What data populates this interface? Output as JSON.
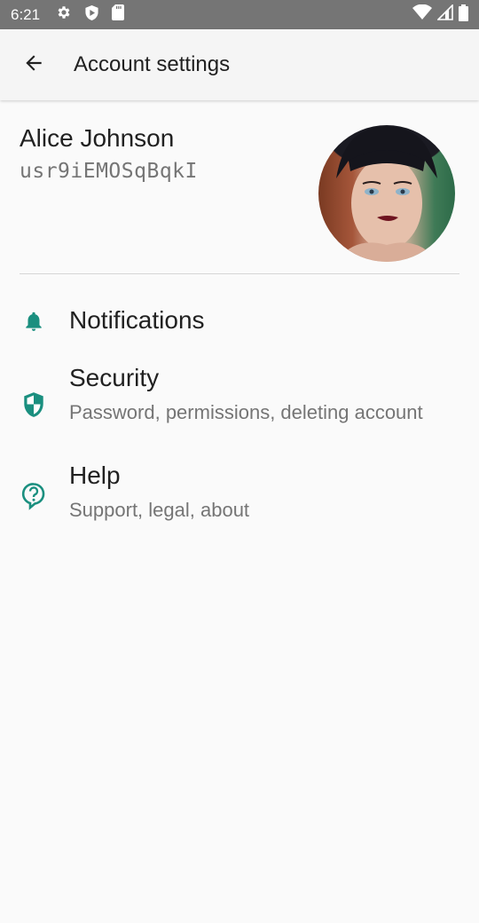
{
  "status_bar": {
    "time": "6:21",
    "left_icons": [
      "settings-icon",
      "shield-play-icon",
      "sd-card-icon"
    ],
    "right_icons": [
      "wifi-icon",
      "signal-icon",
      "battery-icon"
    ]
  },
  "app_bar": {
    "back_icon": "arrow-back-icon",
    "title": "Account settings"
  },
  "profile": {
    "name": "Alice Johnson",
    "user_id": "usr9iEMOSqBqkI",
    "avatar": "profile-photo"
  },
  "menu": {
    "items": [
      {
        "icon": "bell-icon",
        "title": "Notifications",
        "subtitle": ""
      },
      {
        "icon": "shield-icon",
        "title": "Security",
        "subtitle": "Password, permissions, deleting account"
      },
      {
        "icon": "help-icon",
        "title": "Help",
        "subtitle": "Support, legal, about"
      }
    ]
  },
  "colors": {
    "accent": "#1a8f7f",
    "status_bar": "#757575",
    "app_bar": "#f5f5f5",
    "background": "#fafafa"
  }
}
